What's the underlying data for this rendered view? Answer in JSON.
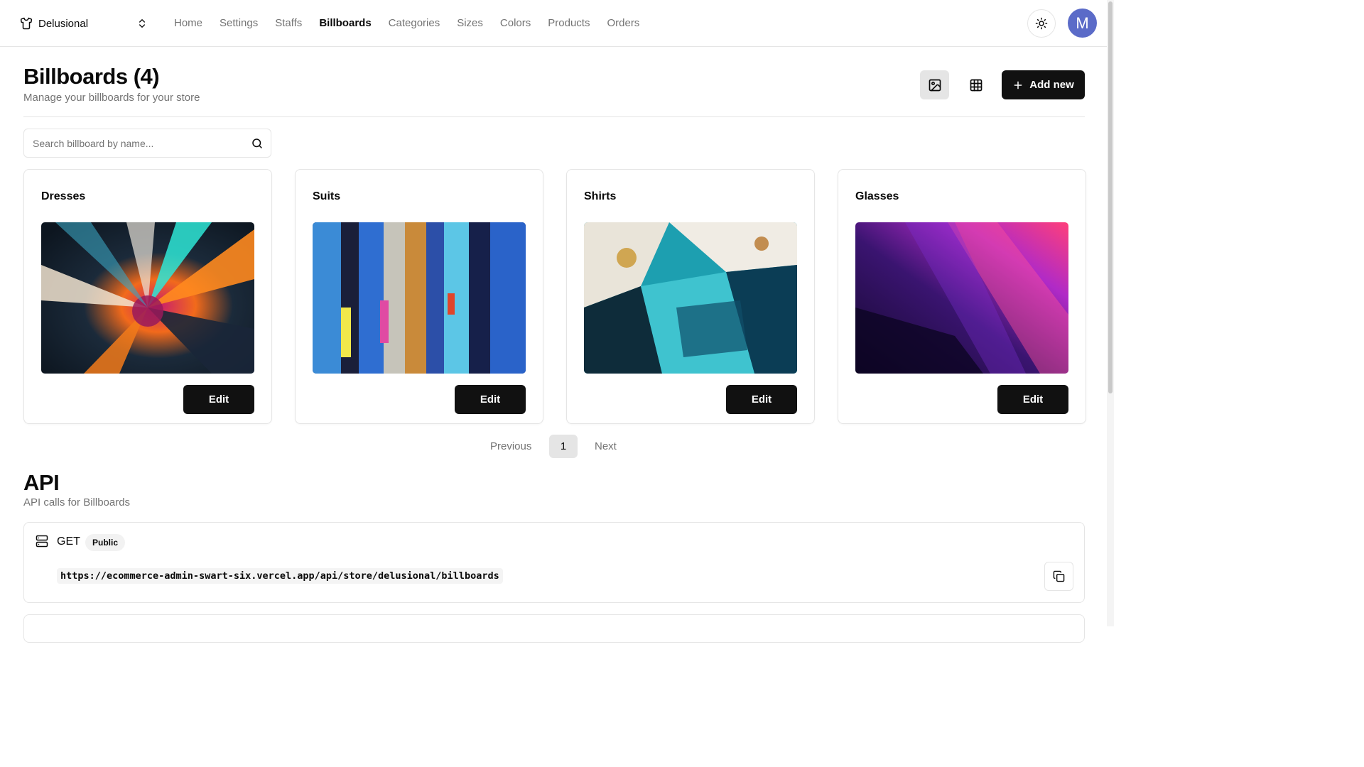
{
  "header": {
    "store_name": "Delusional",
    "nav": [
      {
        "label": "Home",
        "active": false
      },
      {
        "label": "Settings",
        "active": false
      },
      {
        "label": "Staffs",
        "active": false
      },
      {
        "label": "Billboards",
        "active": true
      },
      {
        "label": "Categories",
        "active": false
      },
      {
        "label": "Sizes",
        "active": false
      },
      {
        "label": "Colors",
        "active": false
      },
      {
        "label": "Products",
        "active": false
      },
      {
        "label": "Orders",
        "active": false
      }
    ],
    "avatar_initial": "M"
  },
  "page": {
    "title": "Billboards (4)",
    "subtitle": "Manage your billboards for your store",
    "add_label": "Add new"
  },
  "search": {
    "placeholder": "Search billboard by name..."
  },
  "billboards": [
    {
      "label": "Dresses",
      "edit_label": "Edit"
    },
    {
      "label": "Suits",
      "edit_label": "Edit"
    },
    {
      "label": "Shirts",
      "edit_label": "Edit"
    },
    {
      "label": "Glasses",
      "edit_label": "Edit"
    }
  ],
  "pagination": {
    "previous": "Previous",
    "current": "1",
    "next": "Next"
  },
  "api": {
    "title": "API",
    "subtitle": "API calls for Billboards",
    "method": "GET",
    "badge": "Public",
    "url": "https://ecommerce-admin-swart-six.vercel.app/api/store/delusional/billboards"
  },
  "colors": {
    "primary": "#111111",
    "muted_text": "#737373",
    "border": "#e5e5e5",
    "avatar": "#5b6bc8"
  }
}
